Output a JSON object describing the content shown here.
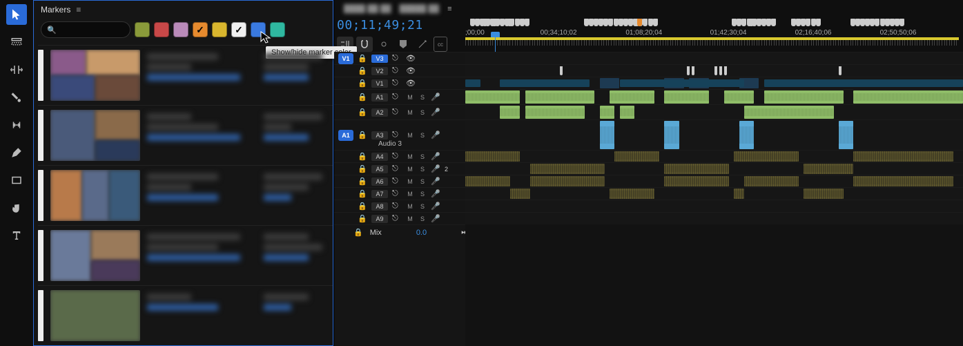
{
  "panel": {
    "title": "Markers",
    "search_placeholder": "",
    "tooltip": "Show/hide marker color"
  },
  "marker_colors": [
    {
      "hex": "#8a9a3a",
      "checked": false
    },
    {
      "hex": "#c84848",
      "checked": false
    },
    {
      "hex": "#b98ab9",
      "checked": false
    },
    {
      "hex": "#e68a2e",
      "checked": true
    },
    {
      "hex": "#d9b62e",
      "checked": false
    },
    {
      "hex": "#f0f0f0",
      "checked": true
    },
    {
      "hex": "#3a7ae0",
      "checked": false
    },
    {
      "hex": "#2fb8a0",
      "checked": false
    }
  ],
  "timecode": "00;11;49;21",
  "ruler_labels": [
    {
      "t": ";00;00",
      "pos": 0
    },
    {
      "t": "00;34;10;02",
      "pos": 15.2
    },
    {
      "t": "01;08;20;04",
      "pos": 32.5
    },
    {
      "t": "01;42;30;04",
      "pos": 49.6
    },
    {
      "t": "02;16;40;06",
      "pos": 66.8
    },
    {
      "t": "02;50;50;06",
      "pos": 84.0
    }
  ],
  "tracks": {
    "video": [
      {
        "src_on": true,
        "src": "V1",
        "name": "V3",
        "eye": true
      },
      {
        "src_on": false,
        "name": "V2",
        "eye": true
      },
      {
        "src_on": false,
        "name": "V1",
        "eye": true
      }
    ],
    "audio": [
      {
        "src_on": false,
        "name": "A1",
        "m": "M",
        "s": "S"
      },
      {
        "src_on": false,
        "name": "A2",
        "m": "M",
        "s": "S"
      },
      {
        "src_on": true,
        "src": "A1",
        "name": "A3",
        "label": "Audio 3",
        "m": "M",
        "s": "S",
        "tall": true
      },
      {
        "src_on": false,
        "name": "A4",
        "m": "M",
        "s": "S"
      },
      {
        "src_on": false,
        "name": "A5",
        "m": "M",
        "s": "S",
        "badge": "2"
      },
      {
        "src_on": false,
        "name": "A6",
        "m": "M",
        "s": "S"
      },
      {
        "src_on": false,
        "name": "A7",
        "m": "M",
        "s": "S"
      },
      {
        "src_on": false,
        "name": "A8",
        "m": "M",
        "s": "S"
      },
      {
        "src_on": false,
        "name": "A9",
        "m": "M",
        "s": "S"
      }
    ],
    "mix": {
      "label": "Mix",
      "value": "0.0"
    }
  },
  "playhead_pct": 6.0
}
